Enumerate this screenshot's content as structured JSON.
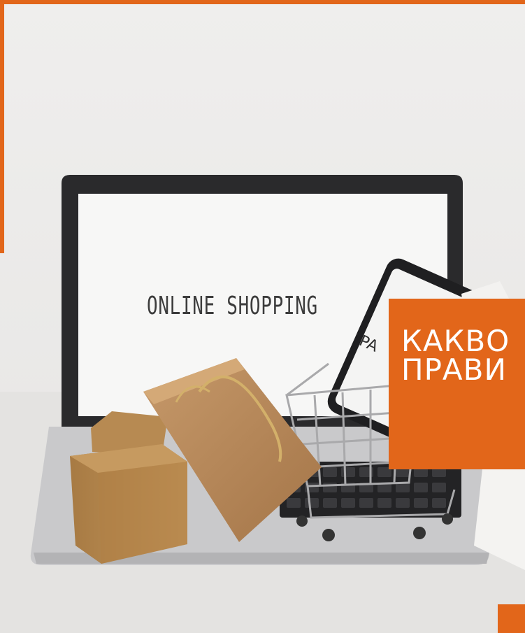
{
  "colors": {
    "accent": "#e2661a",
    "wall": "#ecebea",
    "table": "#e4e3e1",
    "laptop_bezel": "#2a2a2c",
    "screen": "#f7f7f6",
    "cardboard": "#b98a4f"
  },
  "photo": {
    "screen_text": "ONLINE SHOPPING",
    "phone_text": "PA"
  },
  "overlay": {
    "heading_line1": "КАКВО",
    "heading_line2": "ПРАВИ"
  }
}
